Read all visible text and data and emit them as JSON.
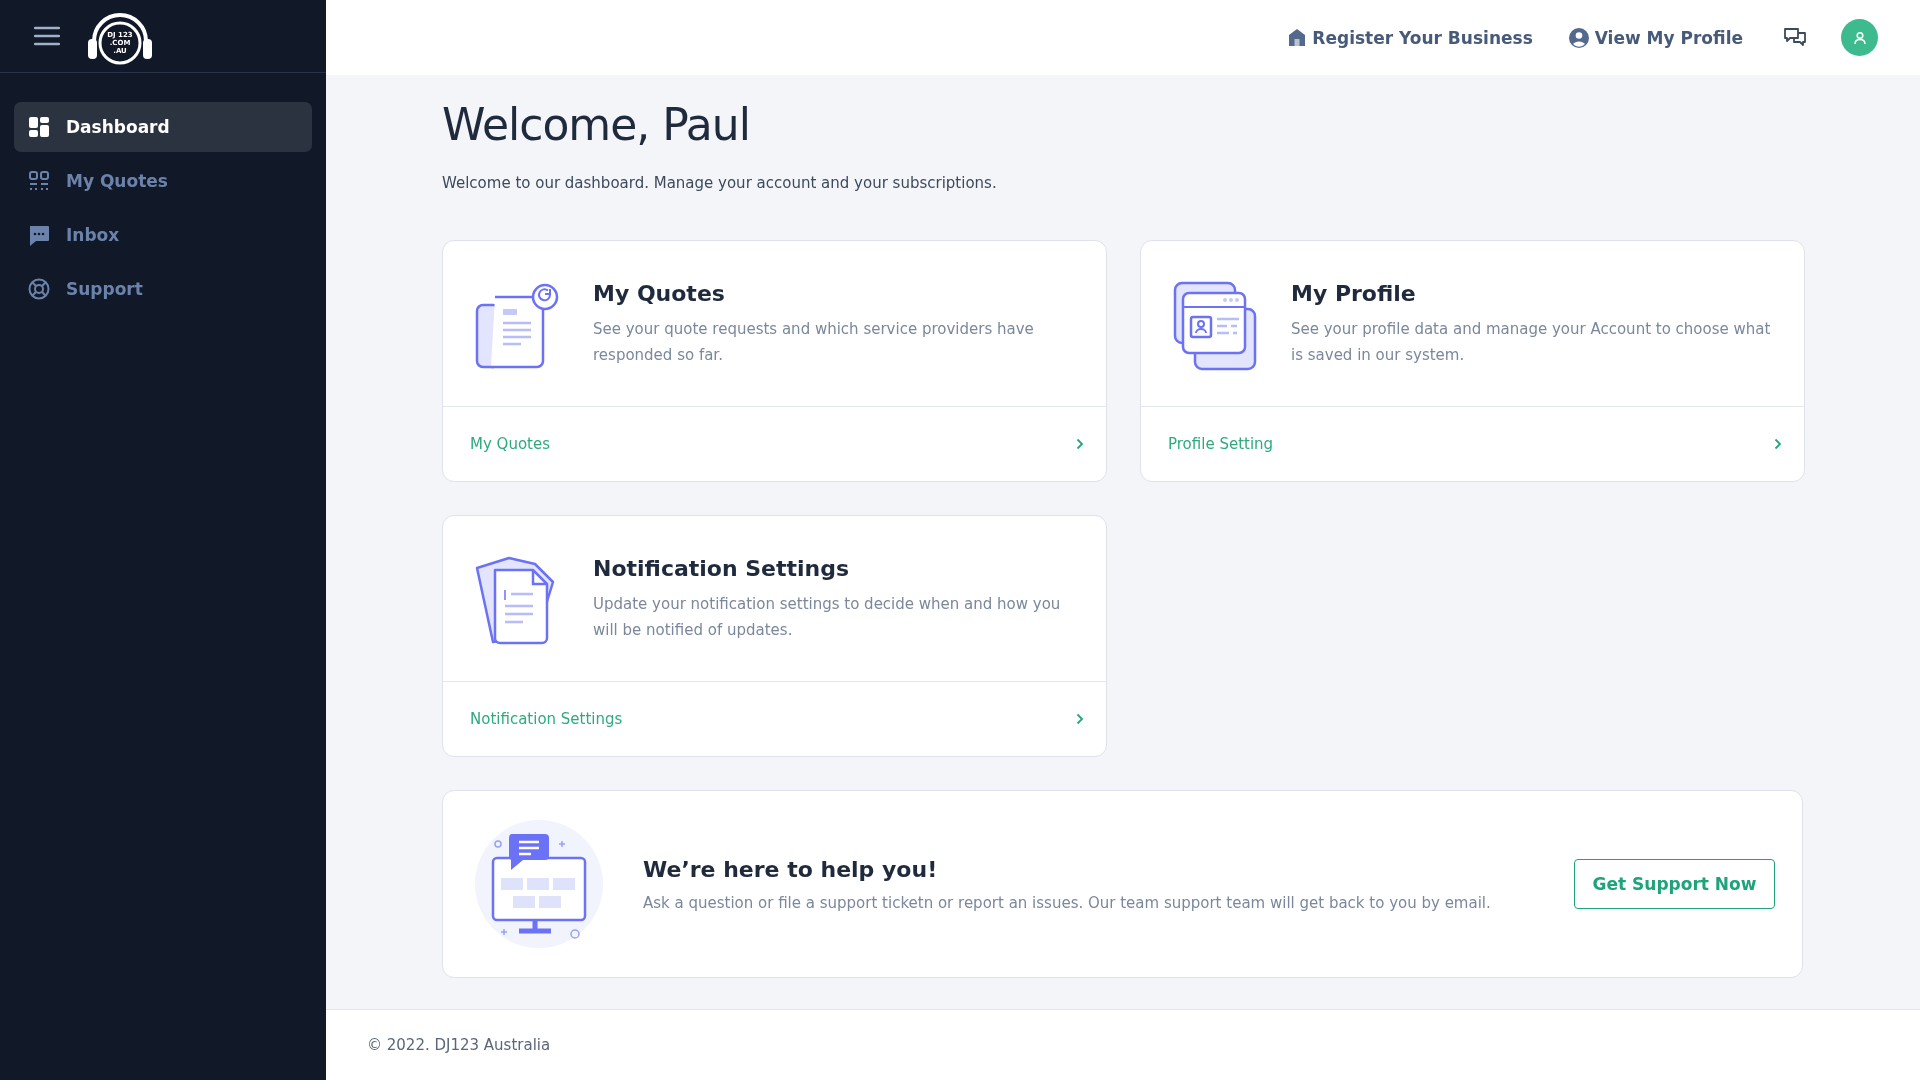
{
  "logo": {
    "lines": [
      "DJ 123",
      ".COM",
      ".AU"
    ]
  },
  "sidebar": {
    "items": [
      {
        "label": "Dashboard",
        "kind": "grid",
        "selected": true
      },
      {
        "label": "My Quotes",
        "kind": "quotes",
        "selected": false
      },
      {
        "label": "Inbox",
        "kind": "chat",
        "selected": false
      },
      {
        "label": "Support",
        "kind": "lifebuoy",
        "selected": false
      }
    ]
  },
  "topbar": {
    "links": [
      {
        "label": "Register Your Business",
        "kind": "house"
      },
      {
        "label": "View My Profile",
        "kind": "user"
      }
    ]
  },
  "heading": "Welcome, Paul",
  "subtitle": "Welcome to our dashboard. Manage your account and your subscriptions.",
  "cards": [
    {
      "kind": "quotes",
      "title": "My Quotes",
      "text": "See your quote requests and which service providers have responded so far.",
      "link": "My Quotes"
    },
    {
      "kind": "profile",
      "title": "My Profile",
      "text": "See your profile data and manage your Account to choose what is saved in our system.",
      "link": "Profile Setting"
    },
    {
      "kind": "notification",
      "title": "Notification Settings",
      "text": "Update your notification settings to decide when and how you will be notified of updates.",
      "link": "Notification Settings"
    }
  ],
  "support": {
    "title": "We’re here to help you!",
    "text": "Ask a question or file a support ticketn or report an issues. Our team support team will get back to you by email.",
    "button": "Get Support Now"
  },
  "footer": "© 2022. DJ123 Australia"
}
